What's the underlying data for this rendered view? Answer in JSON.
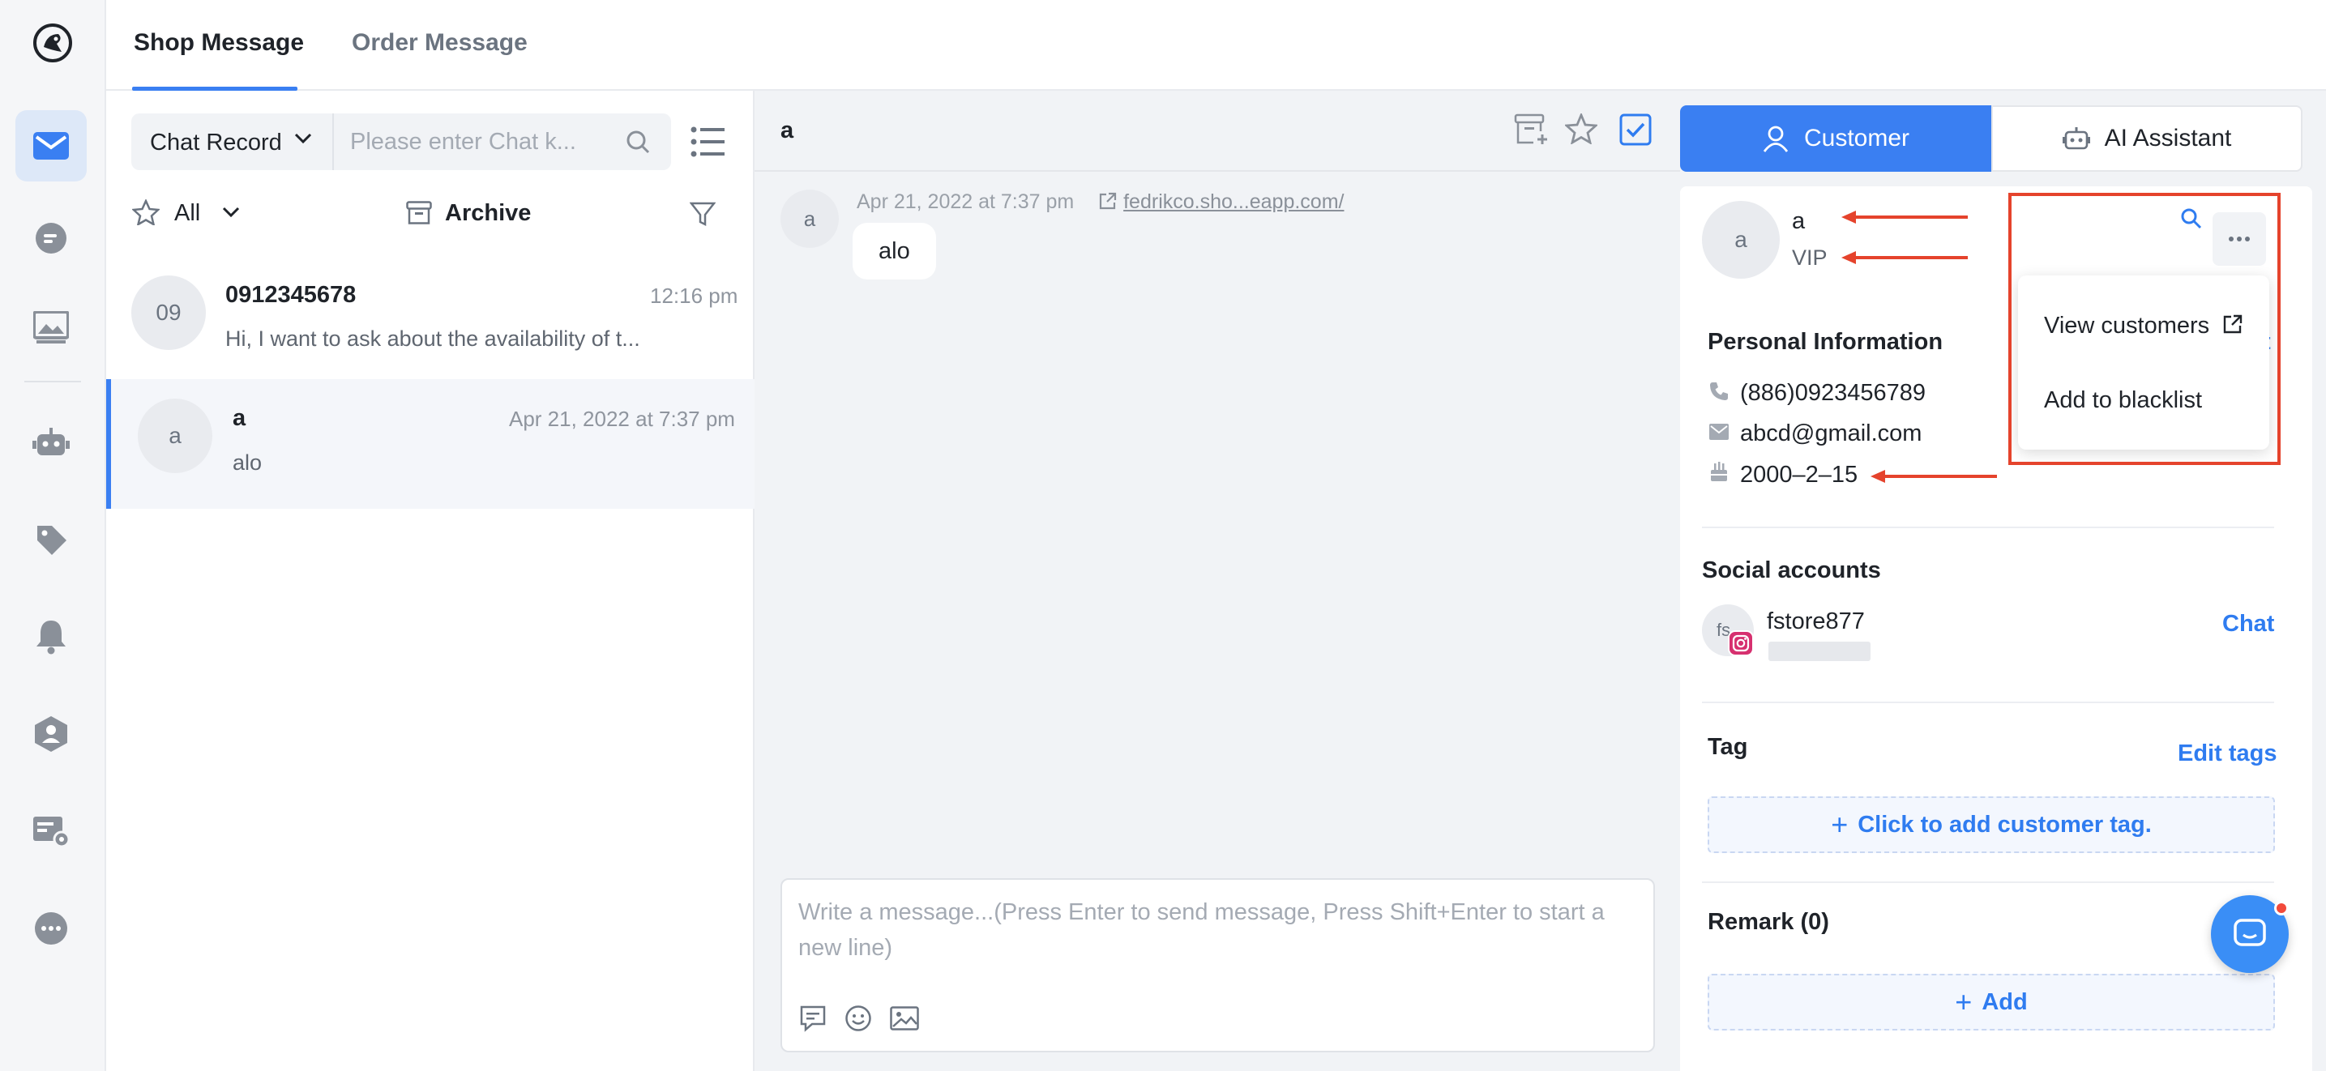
{
  "top_tabs": {
    "shop": "Shop Message",
    "order": "Order Message"
  },
  "list": {
    "search_type": "Chat Record",
    "search_placeholder": "Please enter Chat k...",
    "filter_all": "All",
    "archive": "Archive",
    "conversations": [
      {
        "avatar": "09",
        "name": "0912345678",
        "time": "12:16 pm",
        "snippet": "Hi, I want to ask about the availability of t..."
      },
      {
        "avatar": "a",
        "name": "a",
        "time": "Apr 21, 2022 at 7:37 pm",
        "snippet": "alo"
      }
    ]
  },
  "chat": {
    "title": "a",
    "avatar": "a",
    "message_time": "Apr 21, 2022 at 7:37 pm",
    "message_link": "fedrikco.sho...eapp.com/",
    "message_text": "alo",
    "composer_placeholder": "Write a message...(Press Enter to send message, Press Shift+Enter to start a new line)"
  },
  "right": {
    "tab_customer": "Customer",
    "tab_ai": "AI Assistant",
    "customer_avatar": "a",
    "customer_name": "a",
    "customer_level": "VIP",
    "personal_info_title": "Personal Information",
    "phone": "(886)0923456789",
    "email": "abcd@gmail.com",
    "birthday": "2000–2–15",
    "social_title": "Social accounts",
    "social_avatar": "fs",
    "social_name": "fstore877",
    "social_chat": "Chat",
    "tag_title": "Tag",
    "edit_tags": "Edit tags",
    "add_tag": "Click to add customer tag.",
    "remark_title": "Remark (0)",
    "add_remark": "Add",
    "edit_partial": "t",
    "dropdown": {
      "view_customers": "View customers",
      "add_blacklist": "Add to blacklist"
    }
  },
  "colors": {
    "accent": "#3a7ff2",
    "annotation_red": "#e5432c"
  }
}
